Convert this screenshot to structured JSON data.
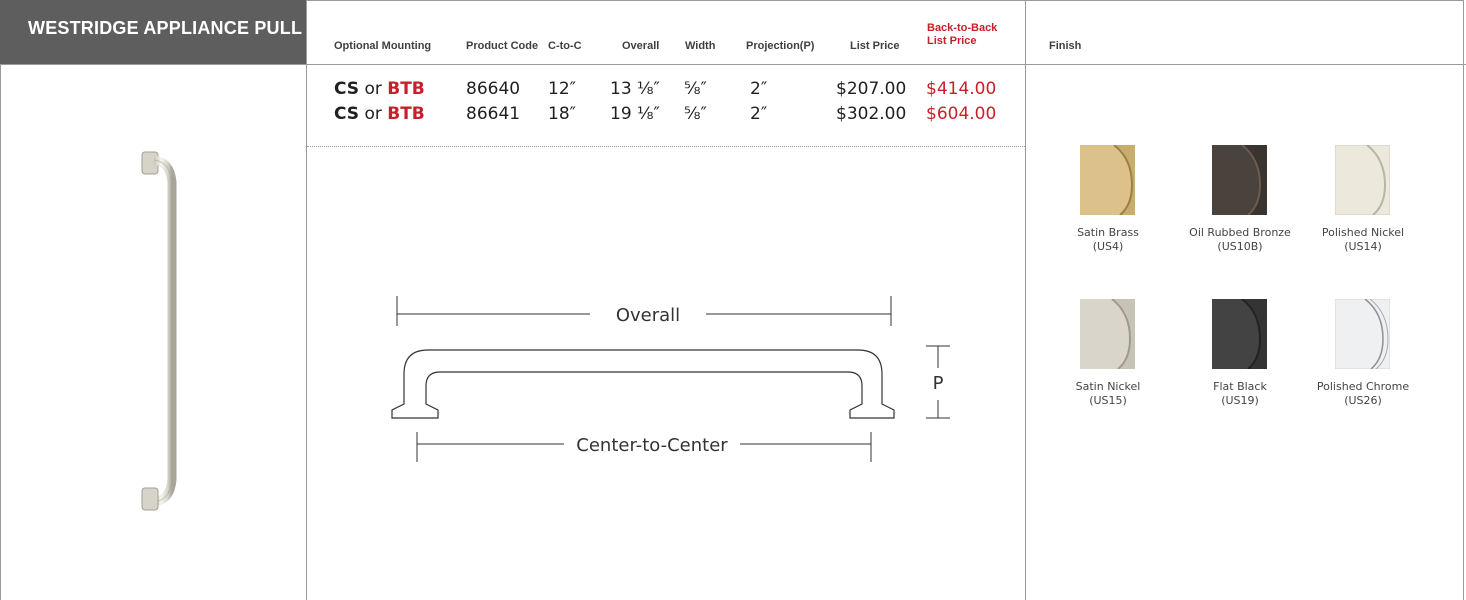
{
  "product": {
    "title": "WESTRIDGE APPLIANCE PULL"
  },
  "table": {
    "headers": {
      "optional_mounting": "Optional Mounting",
      "product_code": "Product Code",
      "c_to_c": "C-to-C",
      "overall": "Overall",
      "width": "Width",
      "projection": "Projection(P)",
      "list_price": "List Price",
      "btb_price_line1": "Back-to-Back",
      "btb_price_line2": "List Price",
      "finish": "Finish"
    },
    "rows": [
      {
        "cs": "CS",
        "or": "or",
        "btb": "BTB",
        "code": "86640",
        "c_to_c": "12″",
        "overall": "13 ⅛″",
        "width": "⅝″",
        "projection": "2″",
        "list_price": "$207.00",
        "btb_price": "$414.00"
      },
      {
        "cs": "CS",
        "or": "or",
        "btb": "BTB",
        "code": "86641",
        "c_to_c": "18″",
        "overall": "19 ⅛″",
        "width": "⅝″",
        "projection": "2″",
        "list_price": "$302.00",
        "btb_price": "$604.00"
      }
    ]
  },
  "diagram": {
    "overall_label": "Overall",
    "center_label": "Center-to-Center",
    "projection_label": "P"
  },
  "finishes": [
    {
      "name": "Satin Brass",
      "code": "(US4)",
      "color": "#c9ad6e"
    },
    {
      "name": "Oil Rubbed Bronze",
      "code": "(US10B)",
      "color": "#3a3431"
    },
    {
      "name": "Polished Nickel",
      "code": "(US14)",
      "color": "#ece9dc"
    },
    {
      "name": "Satin Nickel",
      "code": "(US15)",
      "color": "#c8c3b7"
    },
    {
      "name": "Flat Black",
      "code": "(US19)",
      "color": "#343434"
    },
    {
      "name": "Polished Chrome",
      "code": "(US26)",
      "color": "#eef0f2"
    }
  ],
  "colors": {
    "accent_red": "#c8202a",
    "header_gray": "#5e5e5e"
  }
}
